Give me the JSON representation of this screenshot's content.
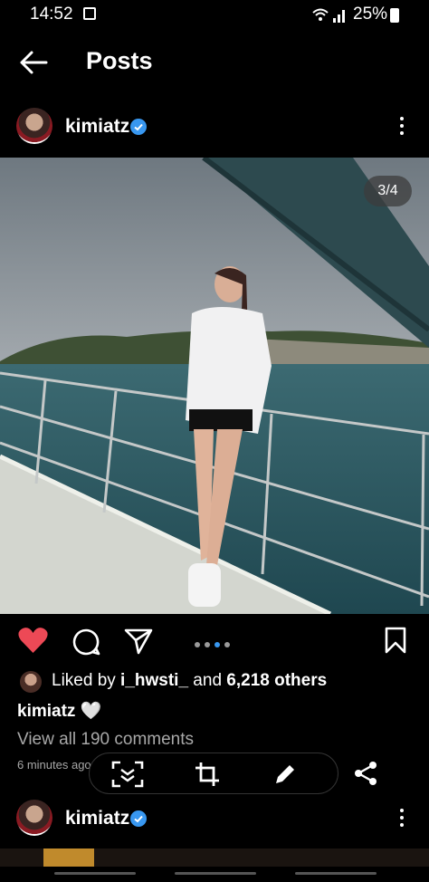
{
  "status_bar": {
    "time": "14:52",
    "battery": "25%"
  },
  "header": {
    "title": "Posts"
  },
  "post": {
    "username": "kimiatz",
    "image_counter": "3/4",
    "likes": {
      "prefix": "Liked by ",
      "user": "i_hwsti_",
      "middle": " and ",
      "count": "6,218 others"
    },
    "caption_user": "kimiatz",
    "caption_text": " 🤍",
    "view_comments": "View all 190 comments",
    "time_ago": "6 minutes ago"
  },
  "next_post": {
    "username": "kimiatz"
  },
  "colors": {
    "like": "#ed4956",
    "verified": "#3897f0",
    "muted": "#a8a8a8"
  },
  "icons": [
    "back-arrow-icon",
    "verified-badge-icon",
    "more-options-icon",
    "heart-icon",
    "comment-icon",
    "send-icon",
    "bookmark-icon",
    "scan-icon",
    "crop-icon",
    "pencil-icon",
    "share-icon"
  ]
}
